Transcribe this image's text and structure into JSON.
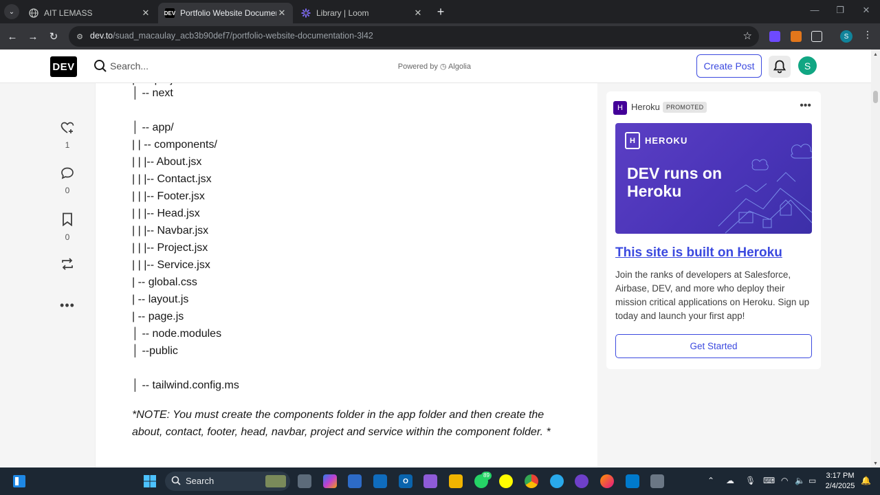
{
  "browser": {
    "tabs": [
      {
        "title": "AIT LEMASS",
        "active": false
      },
      {
        "title": "Portfolio Website Documentatio",
        "active": true
      },
      {
        "title": "Library | Loom",
        "active": false
      }
    ],
    "url_host": "dev.to",
    "url_path": "/suad_macaulay_acb3b90def7/portfolio-website-documentation-3l42",
    "profile_initial": "S"
  },
  "header": {
    "logo": "DEV",
    "search_placeholder": "Search...",
    "powered_by": "Powered by",
    "algolia": "Algolia",
    "create_post": "Create Post",
    "avatar_initial": "S"
  },
  "reactions": {
    "likes": "1",
    "comments": "0",
    "bookmarks": "0"
  },
  "article": {
    "lines": [
      "│ -- next",
      "",
      "│ -- app/",
      "| | -- components/",
      "| | |-- About.jsx",
      "| | |-- Contact.jsx",
      "| | |-- Footer.jsx",
      "| | |-- Head.jsx",
      "| | |-- Navbar.jsx",
      "| | |-- Project.jsx",
      "| | |-- Service.jsx",
      "| -- global.css",
      "| -- layout.js",
      "| -- page.js",
      "│ -- node.modules",
      "│ --public",
      "",
      "│ -- tailwind.config.ms"
    ],
    "note": "*NOTE: You must create the components folder in the app folder and then create the about, contact, footer, head, navbar, project and service within the component folder. *"
  },
  "sidebar": {
    "sponsor": "Heroku",
    "badge": "PROMOTED",
    "banner_brand": "HEROKU",
    "banner_headline": "DEV runs on Heroku",
    "title": "This site is built on Heroku",
    "body": "Join the ranks of developers at Salesforce, Airbase, DEV, and more who deploy their mission critical applications on Heroku. Sign up today and launch your first app!",
    "cta": "Get Started"
  },
  "taskbar": {
    "search_label": "Search",
    "whatsapp_badge": "89",
    "time": "3:17 PM",
    "date": "2/4/2025"
  },
  "colors": {
    "accent": "#3b49df",
    "heroku_purple": "#430098",
    "avatar": "#11a683"
  }
}
